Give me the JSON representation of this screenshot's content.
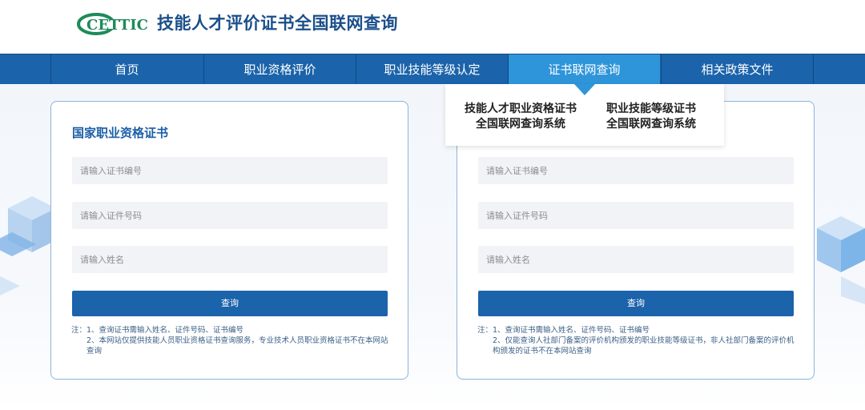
{
  "header": {
    "logo_text": "CETTIC",
    "title": "技能人才评价证书全国联网查询"
  },
  "nav": {
    "items": [
      {
        "label": "首页"
      },
      {
        "label": "职业资格评价"
      },
      {
        "label": "职业技能等级认定"
      },
      {
        "label": "证书联网查询",
        "active": true
      },
      {
        "label": "相关政策文件"
      }
    ]
  },
  "dropdown": {
    "items": [
      {
        "line1": "技能人才职业资格证书",
        "line2": "全国联网查询系统"
      },
      {
        "line1": "职业技能等级证书",
        "line2": "全国联网查询系统"
      }
    ]
  },
  "left_panel": {
    "title": "国家职业资格证书",
    "cert_no_placeholder": "请输入证书编号",
    "id_no_placeholder": "请输入证件号码",
    "name_placeholder": "请输入姓名",
    "query_button": "查询",
    "note1": "注：1、查询证书需输入姓名、证件号码、证书编号",
    "note2": "2、本网站仅提供技能人员职业资格证书查询服务，专业技术人员职业资格证书不在本网站查询"
  },
  "right_panel": {
    "cert_no_placeholder": "请输入证书编号",
    "id_no_placeholder": "请输入证件号码",
    "name_placeholder": "请输入姓名",
    "query_button": "查询",
    "note1": "注：1、查询证书需输入姓名、证件号码、证书编号",
    "note2": "2、仅能查询人社部门备案的评价机构颁发的职业技能等级证书，非人社部门备案的评价机构颁发的证书不在本网站查询"
  },
  "colors": {
    "brand_blue": "#1b63aa",
    "active_tab": "#2f95da",
    "logo_green": "#1f8a5b"
  }
}
